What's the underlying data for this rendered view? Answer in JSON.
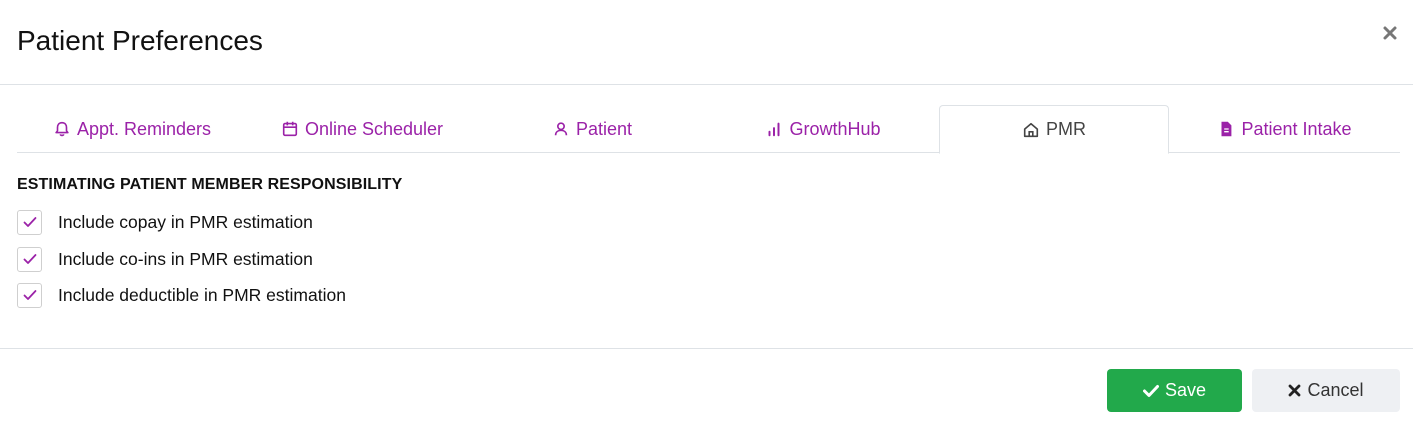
{
  "dialog": {
    "title": "Patient Preferences"
  },
  "tabs": [
    {
      "label": "Appt. Reminders",
      "icon": "bell-icon",
      "active": false
    },
    {
      "label": "Online Scheduler",
      "icon": "calendar-icon",
      "active": false
    },
    {
      "label": "Patient",
      "icon": "user-icon",
      "active": false
    },
    {
      "label": "GrowthHub",
      "icon": "bar-chart-icon",
      "active": false
    },
    {
      "label": "PMR",
      "icon": "home-icon",
      "active": true
    },
    {
      "label": "Patient Intake",
      "icon": "document-icon",
      "active": false
    }
  ],
  "pmr": {
    "section_title": "ESTIMATING PATIENT MEMBER RESPONSIBILITY",
    "options": [
      {
        "label": "Include copay in PMR estimation",
        "checked": true
      },
      {
        "label": "Include co-ins in PMR estimation",
        "checked": true
      },
      {
        "label": "Include deductible in PMR estimation",
        "checked": true
      }
    ]
  },
  "footer": {
    "save_label": "Save",
    "cancel_label": "Cancel"
  },
  "colors": {
    "accent": "#9b22a8",
    "save": "#22a94b",
    "cancel_bg": "#eef0f3"
  }
}
